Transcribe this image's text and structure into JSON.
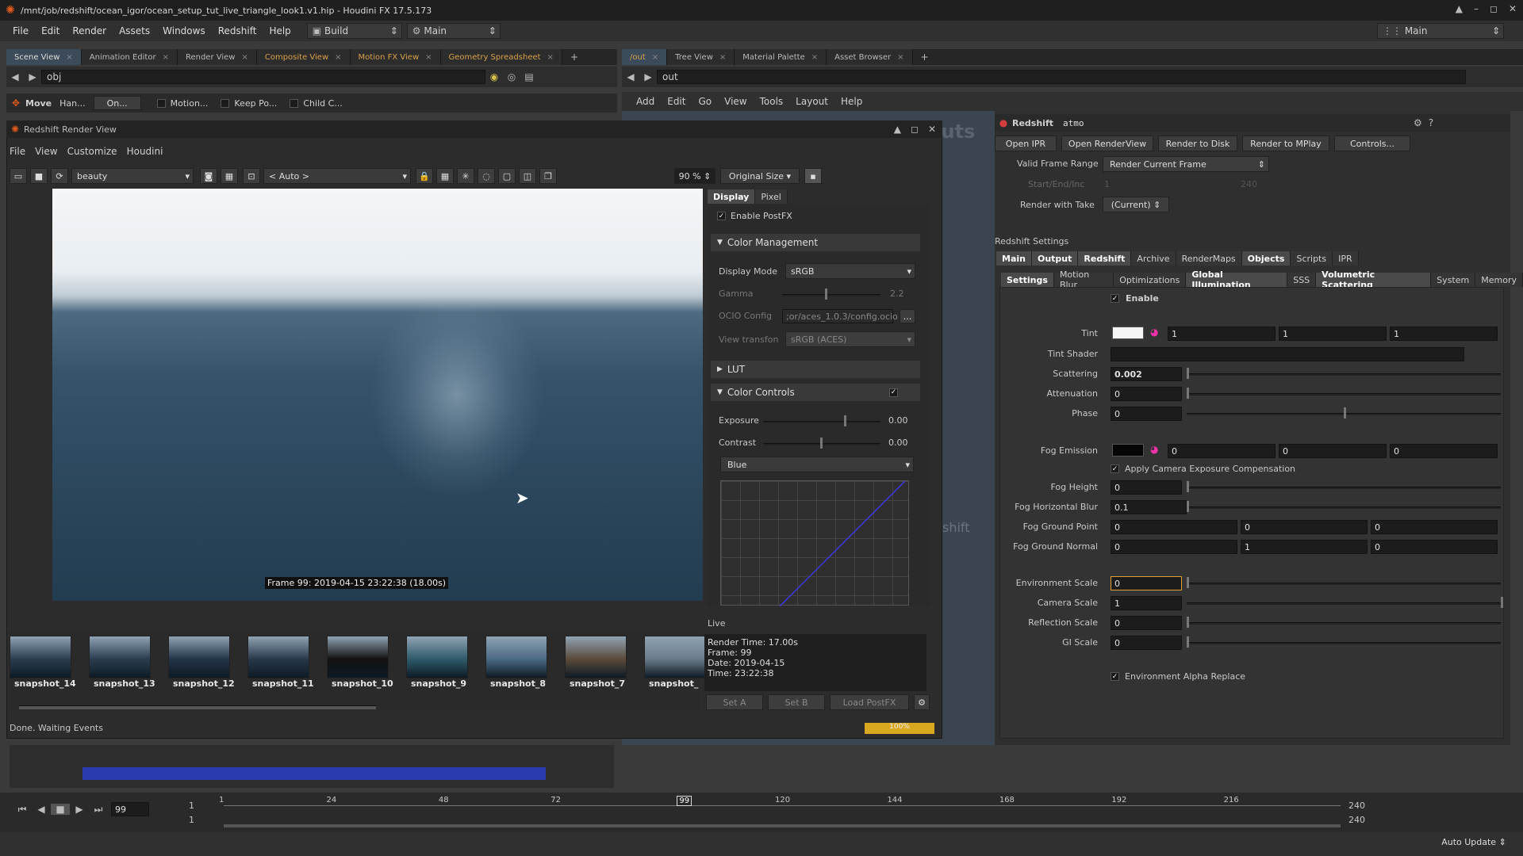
{
  "window": {
    "title": "/mnt/job/redshift/ocean_igor/ocean_setup_tut_live_triangle_look1.v1.hip - Houdini FX 17.5.173",
    "app_icon": "houdini-logo",
    "controls": [
      "▲",
      "–",
      "◻",
      "✕"
    ]
  },
  "menu": {
    "items": [
      "File",
      "Edit",
      "Render",
      "Assets",
      "Windows",
      "Redshift",
      "Help"
    ],
    "desktop": "Build",
    "context": "Main",
    "right_desktop": "Main"
  },
  "left_tabs": [
    "Scene View",
    "Animation Editor",
    "Render View",
    "Composite View",
    "Motion FX View",
    "Geometry Spreadsheet"
  ],
  "left_path": "obj",
  "toolbar": {
    "move": "Move",
    "handles": "Han...",
    "on": "On...",
    "motion": "Motion...",
    "keep": "Keep Po...",
    "child": "Child C..."
  },
  "rs_view": {
    "title": "Redshift Render View",
    "menu": [
      "File",
      "View",
      "Customize",
      "Houdini"
    ],
    "aov": "beauty",
    "camera": "< Auto >",
    "zoom": "90 %",
    "size": "Original Size",
    "caption": "Frame 99: 2019-04-15 23:22:38 (18.00s)",
    "panel_tabs": [
      "Display",
      "Pixel"
    ],
    "enable_postfx": "Enable PostFX",
    "color_mgmt": "Color Management",
    "display_mode_label": "Display Mode",
    "display_mode": "sRGB",
    "gamma_label": "Gamma",
    "gamma": "2.2",
    "ocio_label": "OCIO Config",
    "ocio": ";or/aces_1.0.3/config.ocio",
    "view_label": "View transfon",
    "view": "sRGB (ACES)",
    "lut": "LUT",
    "color_controls": "Color Controls",
    "exposure_label": "Exposure",
    "exposure": "0.00",
    "contrast_label": "Contrast",
    "contrast": "0.00",
    "channel": "Blue",
    "status": "Done. Waiting Events",
    "live_label": "Live",
    "live_lines": [
      "Render Time: 17.00s",
      "Frame: 99",
      "Date: 2019-04-15",
      "Time: 23:22:38"
    ],
    "set_a": "Set A",
    "set_b": "Set B",
    "load_postfx": "Load PostFX",
    "progress": "100%"
  },
  "snapshots": [
    "snapshot_14",
    "snapshot_13",
    "snapshot_12",
    "snapshot_11",
    "snapshot_10",
    "snapshot_9",
    "snapshot_8",
    "snapshot_7",
    "snapshot_"
  ],
  "right_tabs": [
    "/out",
    "Tree View",
    "Material Palette",
    "Asset Browser"
  ],
  "right_path": "out",
  "net_menu": [
    "Add",
    "Edit",
    "Go",
    "View",
    "Tools",
    "Layout",
    "Help"
  ],
  "node": {
    "type": "Redshift",
    "name": "atmo",
    "open_ipr": "Open IPR",
    "open_rv": "Open RenderView",
    "to_disk": "Render to Disk",
    "to_mplay": "Render to MPlay",
    "controls": "Controls...",
    "frame_range_label": "Valid Frame Range",
    "frame_range": "Render Current Frame",
    "start_end_label": "Start/End/Inc",
    "start": "1",
    "end": "240",
    "take_label": "Render with Take",
    "take": "(Current)",
    "settings_label": "Redshift Settings",
    "tabs1": [
      "Main",
      "Output",
      "Redshift",
      "Archive",
      "RenderMaps",
      "Objects",
      "Scripts",
      "IPR"
    ],
    "tabs2": [
      "Settings",
      "Motion Blur",
      "Optimizations",
      "Global Illumination",
      "SSS",
      "Volumetric Scattering",
      "System",
      "Memory"
    ],
    "enable": "Enable",
    "tint_label": "Tint",
    "tint": [
      "1",
      "1",
      "1"
    ],
    "tint_shader_label": "Tint Shader",
    "scattering_label": "Scattering",
    "scattering": "0.002",
    "attenuation_label": "Attenuation",
    "attenuation": "0",
    "phase_label": "Phase",
    "phase": "0",
    "fog_emission_label": "Fog Emission",
    "fog_emission": [
      "0",
      "0",
      "0"
    ],
    "apply_cam": "Apply Camera Exposure Compensation",
    "fog_height_label": "Fog Height",
    "fog_height": "0",
    "fog_hblur_label": "Fog Horizontal Blur",
    "fog_hblur": "0.1",
    "fog_gp_label": "Fog Ground Point",
    "fog_gp": [
      "0",
      "0",
      "0"
    ],
    "fog_gn_label": "Fog Ground Normal",
    "fog_gn": [
      "0",
      "1",
      "0"
    ],
    "env_scale_label": "Environment Scale",
    "env_scale": "0",
    "cam_scale_label": "Camera Scale",
    "cam_scale": "1",
    "refl_scale_label": "Reflection Scale",
    "refl_scale": "0",
    "gi_scale_label": "GI Scale",
    "gi_scale": "0",
    "env_alpha": "Environment Alpha Replace"
  },
  "timeline": {
    "frame": "99",
    "start": "1",
    "start2": "1",
    "ticks": [
      "1",
      "24",
      "48",
      "72",
      "99",
      "120",
      "144",
      "168",
      "192",
      "216"
    ],
    "end": "240",
    "end2": "240",
    "auto_update": "Auto Update"
  },
  "bg_text": {
    "outs": "outs",
    "shift": "shift"
  }
}
